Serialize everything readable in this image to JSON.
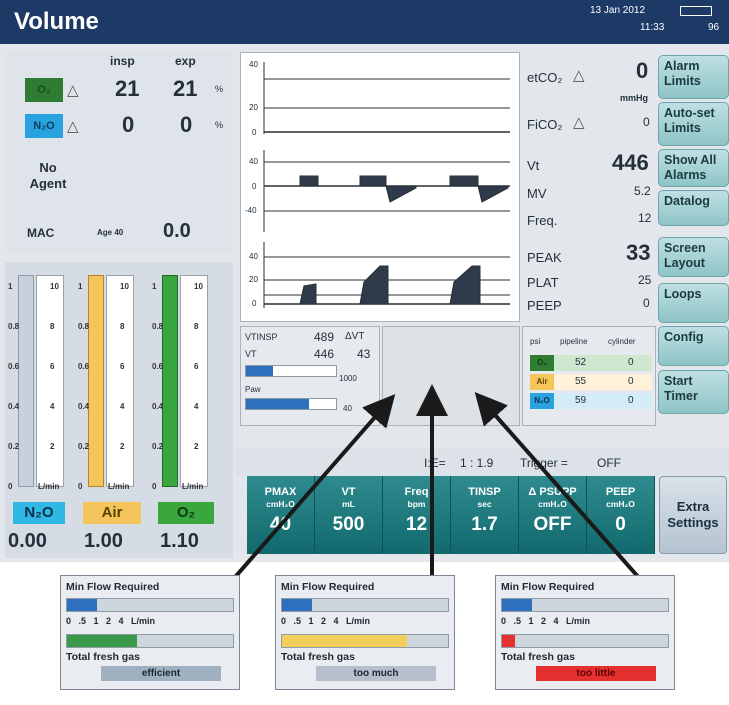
{
  "header": {
    "mode_title": "Volume",
    "date": "13 Jan 2012",
    "time": "11:33",
    "battery_pct": "96"
  },
  "gas_panel": {
    "col_insp": "insp",
    "col_exp": "exp",
    "rows": [
      {
        "label": "O₂",
        "insp": "21",
        "exp": "21",
        "unit": "%",
        "color": "#2e7d32"
      },
      {
        "label": "N₂O",
        "insp": "0",
        "exp": "0",
        "unit": "%",
        "color": "#29a3e0"
      }
    ],
    "no_agent": "No Agent",
    "mac_label": "MAC",
    "age_label": "Age 40",
    "mac_value": "0.0"
  },
  "flow_meters": {
    "scale_ticks": [
      "10",
      "8",
      "6",
      "4",
      "2",
      "0"
    ],
    "left_ticks": [
      "1",
      "0.8",
      "0.6",
      "0.4",
      "0.2",
      "0"
    ],
    "unit": "L/min",
    "meters": [
      {
        "name": "N₂O",
        "value": "0.00",
        "color": "#2fb7e6"
      },
      {
        "name": "Air",
        "value": "1.00",
        "color": "#f5c45a"
      },
      {
        "name": "O₂",
        "value": "1.10",
        "color": "#3aa63e"
      }
    ]
  },
  "waveforms": {
    "co2_ticks": [
      "40",
      "20",
      "0"
    ],
    "flow_ticks": [
      "40",
      "0",
      "-40"
    ],
    "paw_ticks": [
      "40",
      "20",
      "0"
    ]
  },
  "monitor_values": [
    {
      "label": "etCO₂",
      "value": "0",
      "unit": "mmHg"
    },
    {
      "label": "FiCO₂",
      "value": "0",
      "unit": ""
    },
    {
      "label": "Vt",
      "value": "446",
      "unit": ""
    },
    {
      "label": "MV",
      "value": "5.2",
      "unit": ""
    },
    {
      "label": "Freq.",
      "value": "12",
      "unit": ""
    },
    {
      "label": "PEAK",
      "value": "33",
      "unit": ""
    },
    {
      "label": "PLAT",
      "value": "25",
      "unit": ""
    },
    {
      "label": "PEEP",
      "value": "0",
      "unit": ""
    }
  ],
  "volume_box": {
    "vtinsp_label": "VTINSP",
    "vtinsp": "489",
    "dvt_label": "ΔVT",
    "vt_label": "VT",
    "vt": "446",
    "dvt": "43",
    "scale_max": "1000",
    "paw_label": "Paw",
    "paw_max": "40"
  },
  "pipeline": {
    "headers": [
      "psi",
      "pipeline",
      "cylinder"
    ],
    "rows": [
      {
        "gas": "O₂",
        "pipeline": "52",
        "cylinder": "0",
        "color": "#2e7d32"
      },
      {
        "gas": "Air",
        "pipeline": "55",
        "cylinder": "0",
        "color": "#f5c45a"
      },
      {
        "gas": "N₂O",
        "pipeline": "59",
        "cylinder": "0",
        "color": "#29a3e0"
      }
    ]
  },
  "side_buttons": [
    "Alarm Limits",
    "Auto-set Limits",
    "Show All Alarms",
    "Datalog",
    "Screen Layout",
    "Loops",
    "Config",
    "Start Timer"
  ],
  "ratio_line": {
    "ie_label": "I:E=",
    "ie_value": "1 : 1.9",
    "trigger_label": "Trigger =",
    "trigger_value": "OFF"
  },
  "settings": [
    {
      "name": "PMAX",
      "unit": "cmH₂O",
      "value": "40"
    },
    {
      "name": "VT",
      "unit": "mL",
      "value": "500"
    },
    {
      "name": "Freq",
      "unit": "bpm",
      "value": "12"
    },
    {
      "name": "TINSP",
      "unit": "sec",
      "value": "1.7"
    },
    {
      "name": "Δ PSUPP",
      "unit": "cmH₂O",
      "value": "OFF"
    },
    {
      "name": "PEEP",
      "unit": "cmH₂O",
      "value": "0"
    }
  ],
  "extra_settings": "Extra Settings",
  "insets": [
    {
      "title": "Min Flow Required",
      "scale": "0 .5 1 2 4 L/min",
      "fresh_gas_label": "Total fresh gas",
      "status": "efficient",
      "min_fill": 0.18,
      "fresh_fill": 0.42,
      "fresh_color": "#3b9a4a",
      "status_bg": "#9fb0c0"
    },
    {
      "title": "Min Flow Required",
      "scale": "0 .5 1 2 4 L/min",
      "fresh_gas_label": "Total fresh gas",
      "status": "too much",
      "min_fill": 0.18,
      "fresh_fill": 0.75,
      "fresh_color": "#f2cf5b",
      "status_bg": "#b5c0cc"
    },
    {
      "title": "Min Flow Required",
      "scale": "0 .5 1 2 4 L/min",
      "fresh_gas_label": "Total fresh gas",
      "status": "too little",
      "min_fill": 0.18,
      "fresh_fill": 0.08,
      "fresh_color": "#e53030",
      "status_bg": "#e53030"
    }
  ]
}
